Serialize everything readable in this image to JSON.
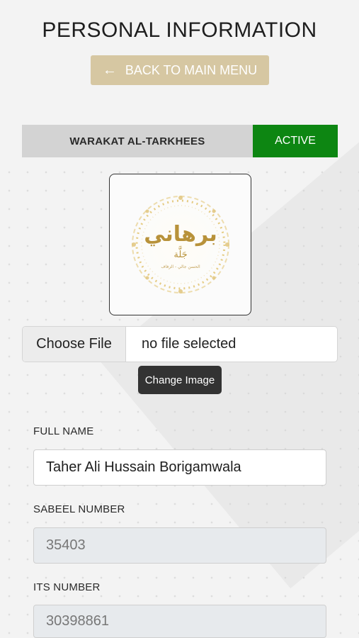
{
  "header": {
    "title": "PERSONAL INFORMATION",
    "back_label": "BACK TO MAIN MENU",
    "back_icon": "arrow-left-icon"
  },
  "status": {
    "document": "WARAKAT AL-TARKHEES",
    "state": "ACTIVE",
    "state_color": "#0d8612"
  },
  "logo": {
    "arabic_main": "برهاني",
    "arabic_sub": "جَلَّة",
    "arabic_small": "الحسن جالي - الزفاف"
  },
  "upload": {
    "choose_label": "Choose File",
    "status_text": "no file selected",
    "change_label": "Change Image"
  },
  "form": {
    "full_name": {
      "label": "FULL NAME",
      "value": "Taher Ali Hussain Borigamwala"
    },
    "sabeel": {
      "label": "SABEEL NUMBER",
      "value": "35403"
    },
    "its": {
      "label": "ITS NUMBER",
      "value": "30398861"
    }
  },
  "colors": {
    "accent_gold": "#d6c7a2",
    "active_green": "#0d8612"
  }
}
